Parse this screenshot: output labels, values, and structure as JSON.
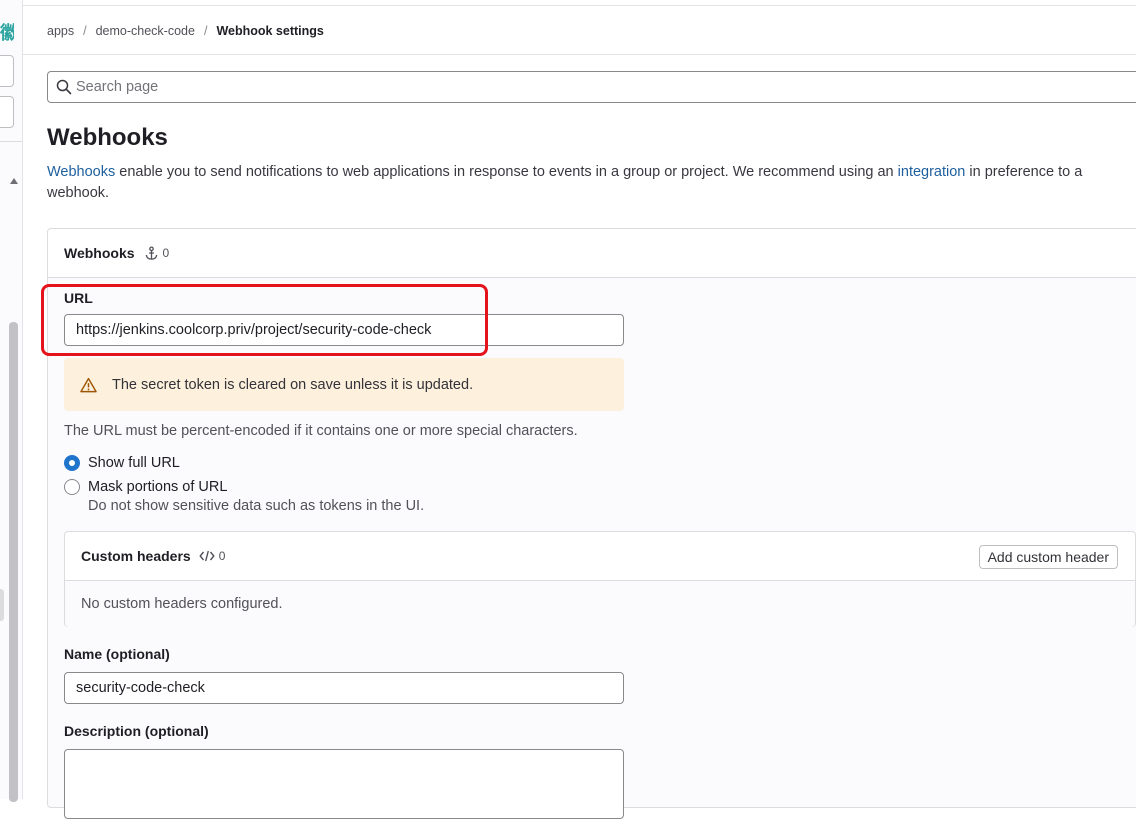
{
  "breadcrumb": {
    "items": [
      "apps",
      "demo-check-code"
    ],
    "current": "Webhook settings"
  },
  "search": {
    "placeholder": "Search page"
  },
  "page": {
    "title": "Webhooks",
    "intro": {
      "link1": "Webhooks",
      "text1": " enable you to send notifications to web applications in response to events in a group or project. We recommend using an ",
      "link2": "integration",
      "text2": " in preference to a webhook."
    }
  },
  "webhooks_card": {
    "title": "Webhooks",
    "count": "0"
  },
  "url_field": {
    "label": "URL",
    "value": "https://jenkins.coolcorp.priv/project/security-code-check"
  },
  "alert": {
    "text": "The secret token is cleared on save unless it is updated."
  },
  "url_help": "The URL must be percent-encoded if it contains one or more special characters.",
  "url_mode": {
    "options": [
      "Show full URL",
      "Mask portions of URL"
    ],
    "selected": "Show full URL",
    "mask_help": "Do not show sensitive data such as tokens in the UI."
  },
  "custom_headers": {
    "title": "Custom headers",
    "count": "0",
    "add_button": "Add custom header",
    "empty_text": "No custom headers configured."
  },
  "name_field": {
    "label": "Name (optional)",
    "value": "security-code-check"
  },
  "description_field": {
    "label": "Description (optional)",
    "value": ""
  },
  "colors": {
    "link": "#1f5f9e",
    "accent": "#1f75cb",
    "highlight": "#e3121b",
    "alert_bg": "#fdf1dd"
  }
}
